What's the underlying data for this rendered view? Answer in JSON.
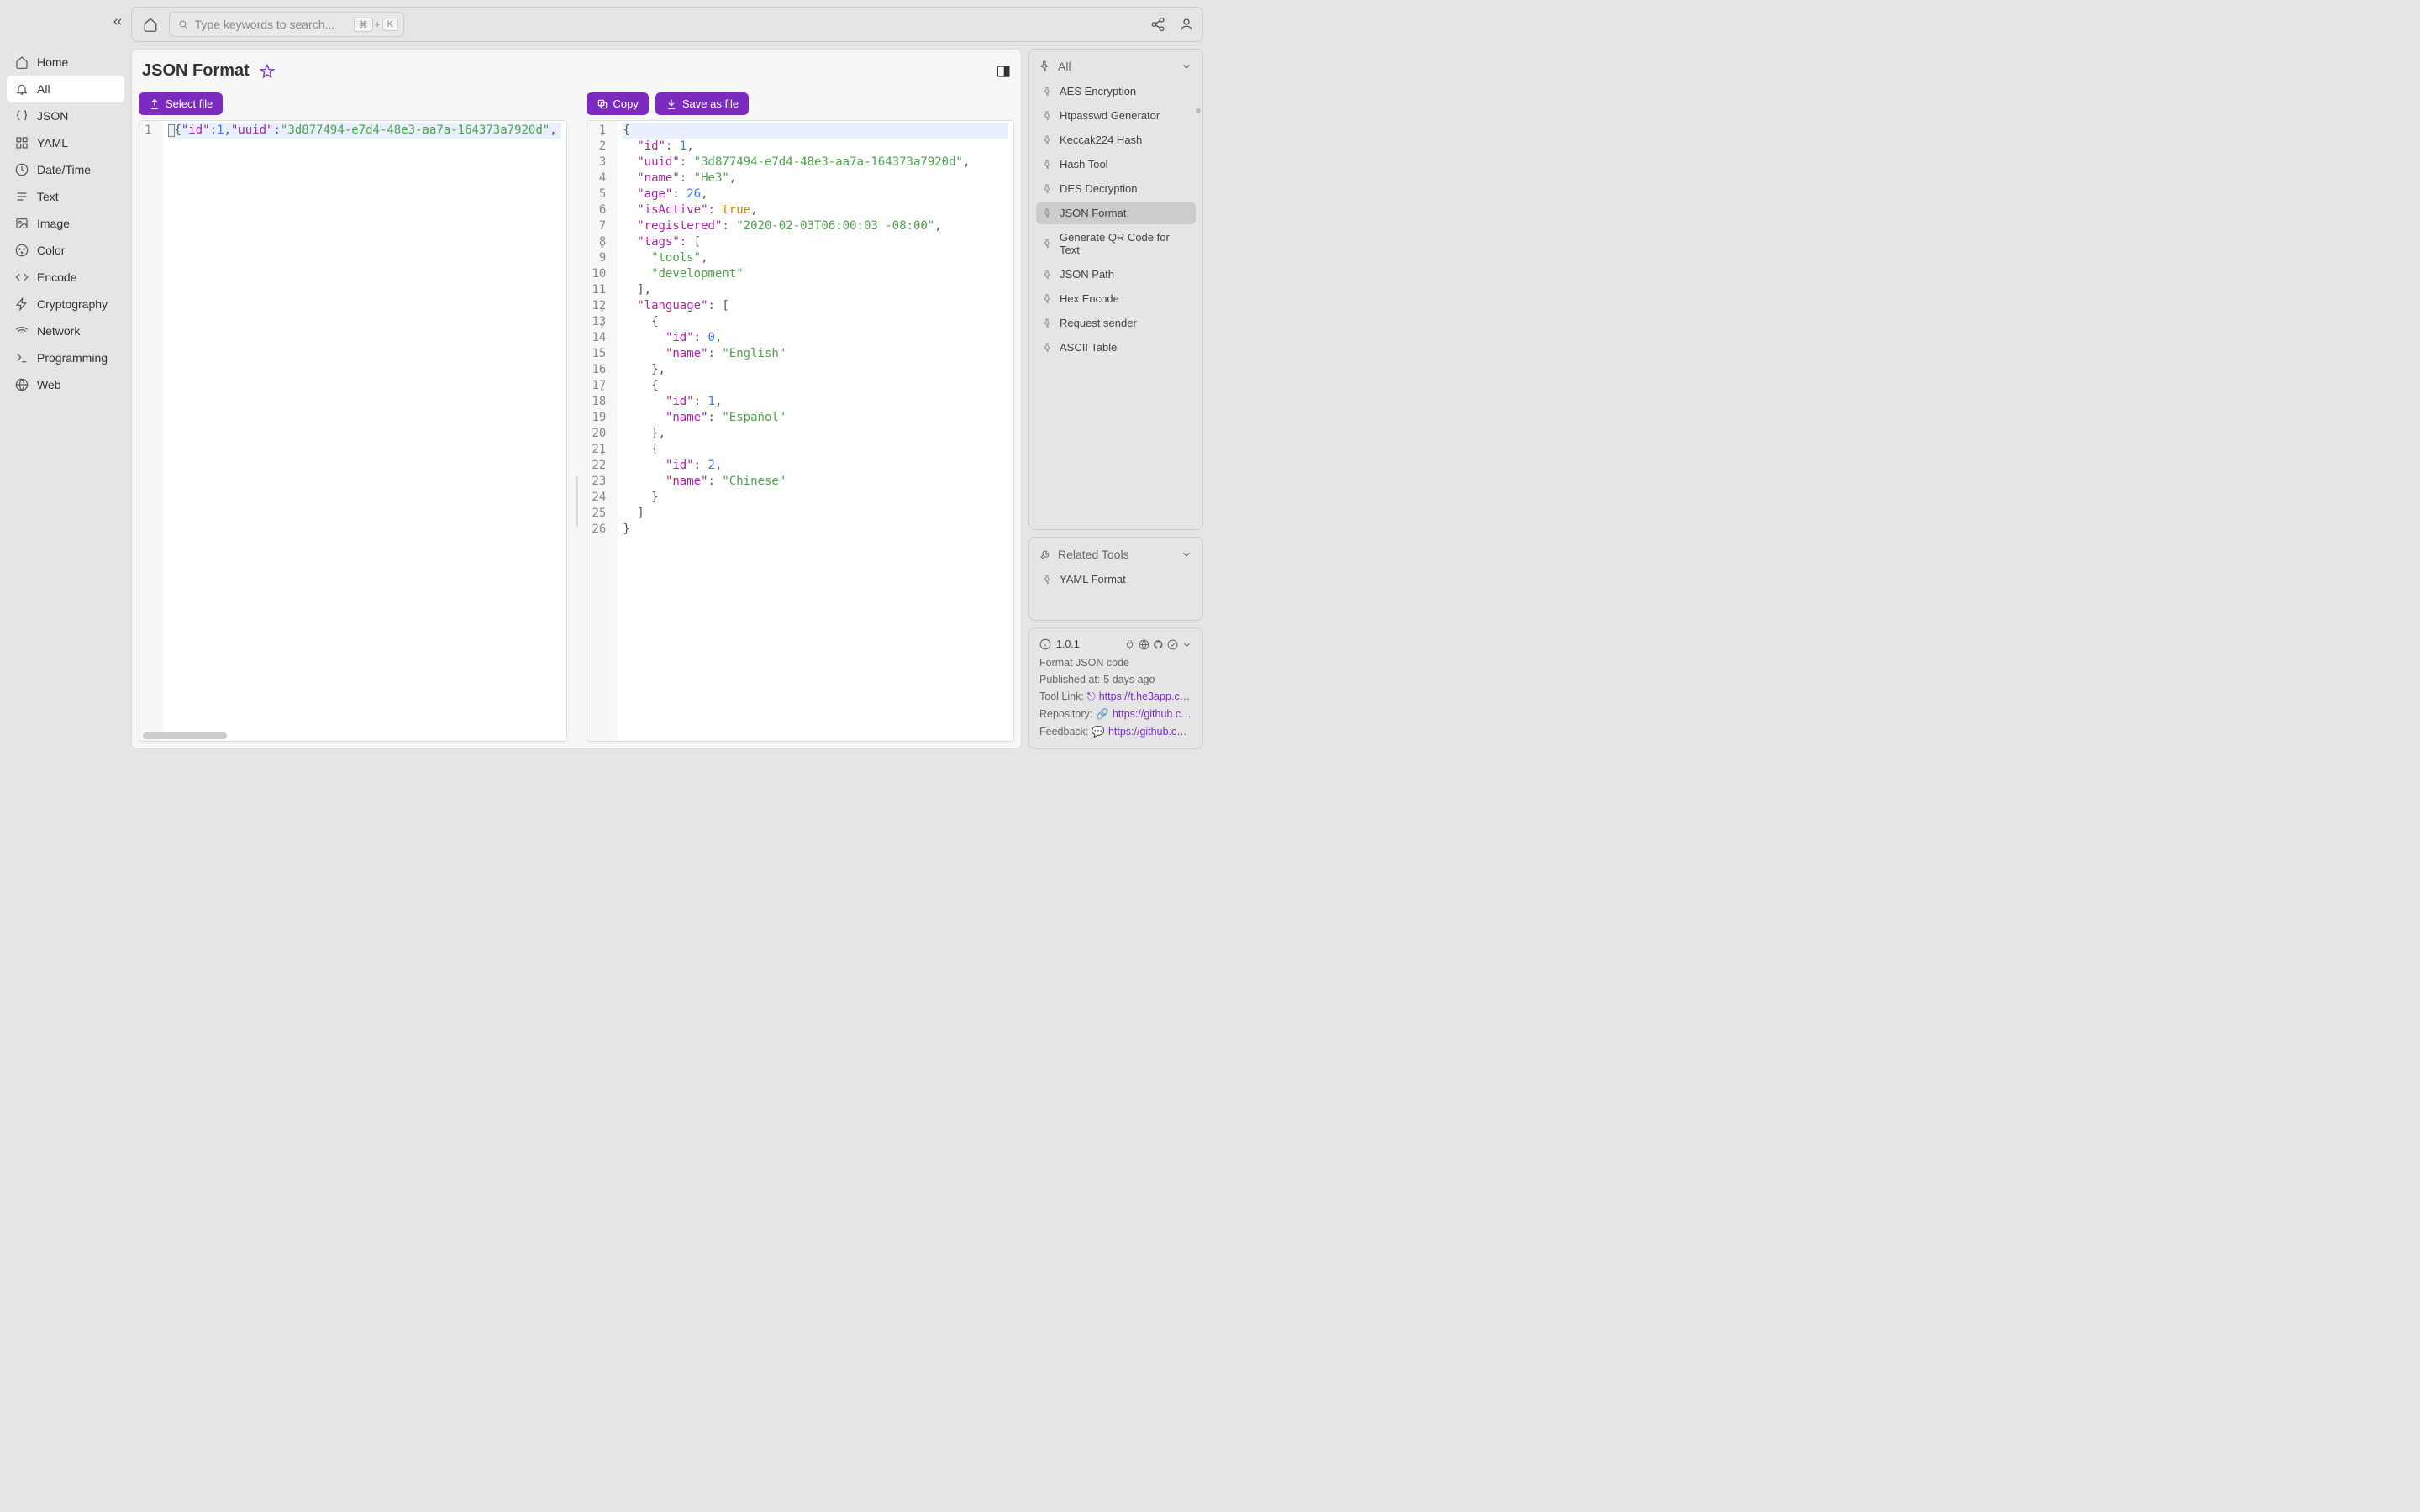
{
  "sidebar": {
    "items": [
      {
        "label": "Home",
        "icon": "home"
      },
      {
        "label": "All",
        "icon": "bell",
        "active": true
      },
      {
        "label": "JSON",
        "icon": "braces"
      },
      {
        "label": "YAML",
        "icon": "grid"
      },
      {
        "label": "Date/Time",
        "icon": "clock"
      },
      {
        "label": "Text",
        "icon": "text"
      },
      {
        "label": "Image",
        "icon": "image"
      },
      {
        "label": "Color",
        "icon": "palette"
      },
      {
        "label": "Encode",
        "icon": "code"
      },
      {
        "label": "Cryptography",
        "icon": "bolt"
      },
      {
        "label": "Network",
        "icon": "wifi"
      },
      {
        "label": "Programming",
        "icon": "terminal"
      },
      {
        "label": "Web",
        "icon": "globe"
      }
    ]
  },
  "search": {
    "placeholder": "Type keywords to search..."
  },
  "kbd": {
    "cmd": "⌘",
    "plus": "+",
    "k": "K"
  },
  "page": {
    "title": "JSON Format"
  },
  "buttons": {
    "select_file": "Select file",
    "copy": "Copy",
    "save_as_file": "Save as file"
  },
  "input_editor": {
    "line_numbers": [
      "1"
    ],
    "raw": "{\"id\":1,\"uuid\":\"3d877494-e7d4-48e3-aa7a-164373a7920d\","
  },
  "output_editor": {
    "line_numbers": [
      "1",
      "2",
      "3",
      "4",
      "5",
      "6",
      "7",
      "8",
      "9",
      "10",
      "11",
      "12",
      "13",
      "14",
      "15",
      "16",
      "17",
      "18",
      "19",
      "20",
      "21",
      "22",
      "23",
      "24",
      "25",
      "26"
    ],
    "fold_lines": [
      1,
      8,
      12,
      13,
      17,
      21
    ]
  },
  "formatted_json": {
    "id": 1,
    "uuid": "3d877494-e7d4-48e3-aa7a-164373a7920d",
    "name": "He3",
    "age": 26,
    "isActive": true,
    "registered": "2020-02-03T06:00:03 -08:00",
    "tags": [
      "tools",
      "development"
    ],
    "language": [
      {
        "id": 0,
        "name": "English"
      },
      {
        "id": 1,
        "name": "Español"
      },
      {
        "id": 2,
        "name": "Chinese"
      }
    ]
  },
  "right": {
    "all_label": "All",
    "tools": [
      {
        "label": "AES Encryption"
      },
      {
        "label": "Htpasswd Generator"
      },
      {
        "label": "Keccak224 Hash"
      },
      {
        "label": "Hash Tool"
      },
      {
        "label": "DES Decryption"
      },
      {
        "label": "JSON Format",
        "active": true
      },
      {
        "label": "Generate QR Code for Text"
      },
      {
        "label": "JSON Path"
      },
      {
        "label": "Hex Encode"
      },
      {
        "label": "Request sender"
      },
      {
        "label": "ASCII Table"
      }
    ],
    "related_label": "Related Tools",
    "related": [
      {
        "label": "YAML Format"
      }
    ]
  },
  "info": {
    "version": "1.0.1",
    "description": "Format JSON code",
    "published_label": "Published at:",
    "published_value": "5 days ago",
    "tool_link_label": "Tool Link:",
    "tool_link_value": "https://t.he3app.co…",
    "repo_label": "Repository:",
    "repo_value": "https://github.com…",
    "feedback_label": "Feedback:",
    "feedback_value": "https://github.com/…"
  }
}
